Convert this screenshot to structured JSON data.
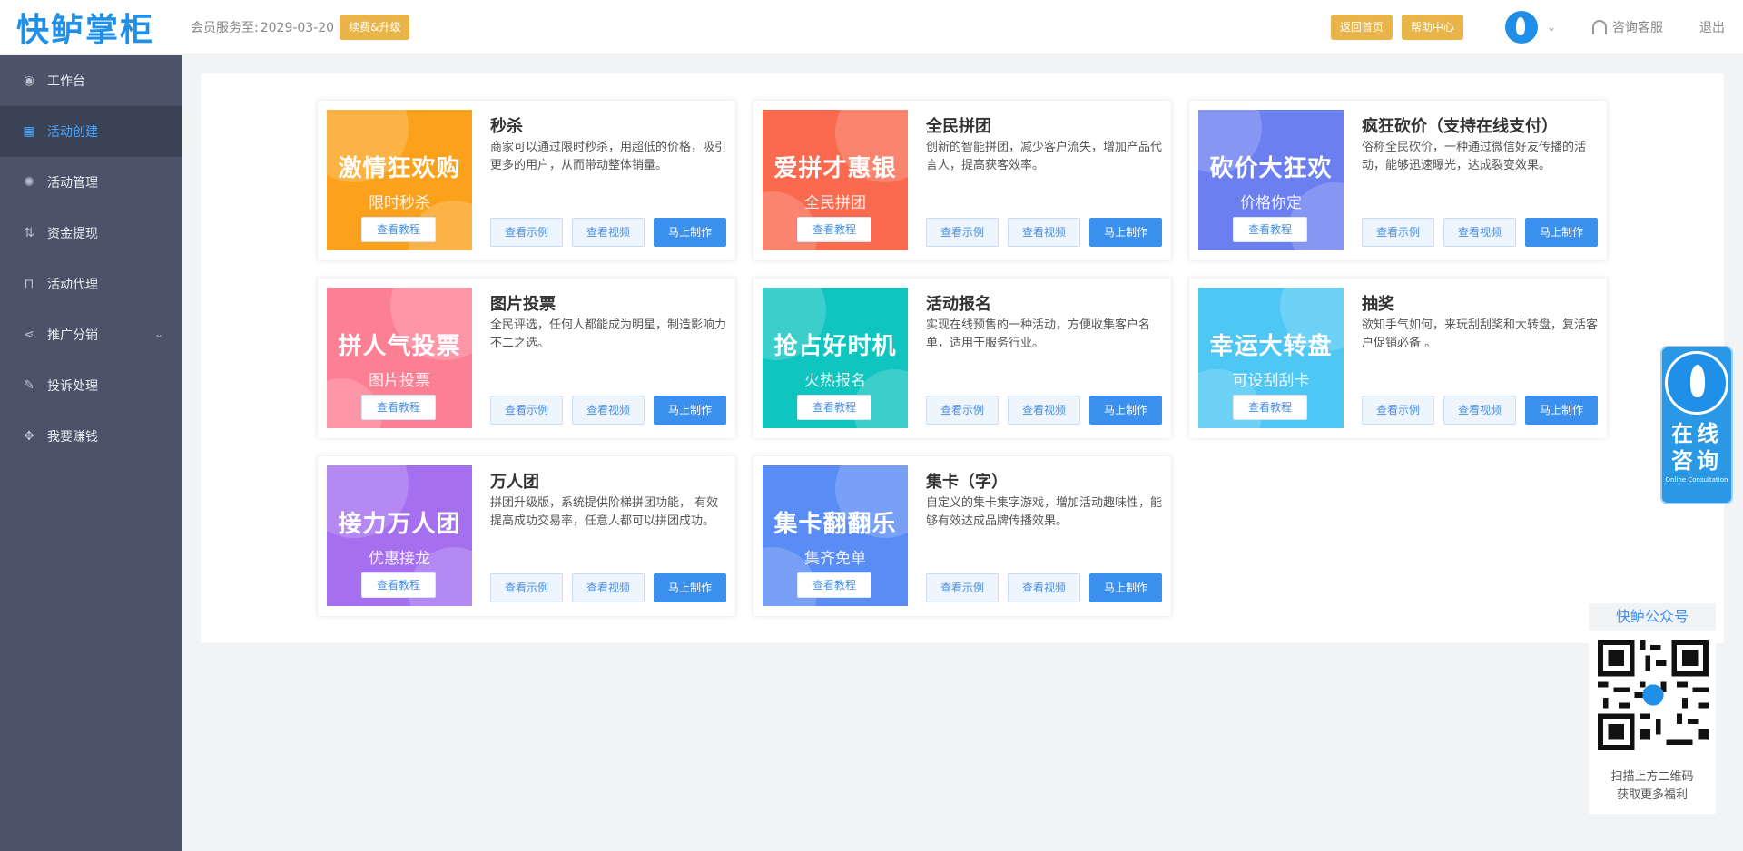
{
  "header": {
    "logo": "快鲈掌柜",
    "member_label": "会员服务至:",
    "member_date": "2029-03-20",
    "renew_button": "续费&升级",
    "home_button": "返回首页",
    "help_button": "帮助中心",
    "service_label": "咨询客服",
    "logout_label": "退出"
  },
  "sidebar": {
    "items": [
      {
        "label": "工作台",
        "icon": "eye-icon"
      },
      {
        "label": "活动创建",
        "icon": "grid-icon",
        "active": true
      },
      {
        "label": "活动管理",
        "icon": "gear-icon"
      },
      {
        "label": "资金提现",
        "icon": "transfer-icon"
      },
      {
        "label": "活动代理",
        "icon": "bag-icon"
      },
      {
        "label": "推广分销",
        "icon": "share-icon"
      },
      {
        "label": "投诉处理",
        "icon": "edit-icon"
      },
      {
        "label": "我要赚钱",
        "icon": "move-icon"
      }
    ]
  },
  "buttons": {
    "tutorial": "查看教程",
    "example": "查看示例",
    "video": "查看视频",
    "make": "马上制作"
  },
  "cards": [
    {
      "title": "秒杀",
      "desc": "商家可以通过限时秒杀，用超低的价格，吸引更多的用户，从而带动整体销量。",
      "banner": "激情狂欢购",
      "sub": "限时秒杀",
      "color": "#fca11c"
    },
    {
      "title": "全民拼团",
      "desc": "创新的智能拼团，减少客户流失，增加产品代言人，提高获客效率。",
      "banner": "爱拼才惠银",
      "sub": "全民拼团",
      "color": "#fb6a4f"
    },
    {
      "title": "疯狂砍价（支持在线支付）",
      "desc": "俗称全民砍价，一种通过微信好友传播的活动，能够迅速曝光，达成裂变效果。",
      "banner": "砍价大狂欢",
      "sub": "价格你定",
      "color": "#6c7ff0"
    },
    {
      "title": "图片投票",
      "desc": "全民评选，任何人都能成为明星，制造影响力不二之选。",
      "banner": "拼人气投票",
      "sub": "图片投票",
      "color": "#fd7f93"
    },
    {
      "title": "活动报名",
      "desc": "实现在线预售的一种活动，方便收集客户名单，适用于服务行业。",
      "banner": "抢占好时机",
      "sub": "火热报名",
      "color": "#10c4c0"
    },
    {
      "title": "抽奖",
      "desc": "欲知手气如何，来玩刮刮奖和大转盘，复活客户促销必备 。",
      "banner": "幸运大转盘",
      "sub": "可设刮刮卡",
      "color": "#4fc7f5"
    },
    {
      "title": "万人团",
      "desc": "拼团升级版，系统提供阶梯拼团功能， 有效提高成功交易率，任意人都可以拼团成功。",
      "banner": "接力万人团",
      "sub": "优惠接龙",
      "color": "#a56ff0"
    },
    {
      "title": "集卡（字）",
      "desc": "自定义的集卡集字游戏，增加活动趣味性，能够有效达成品牌传播效果。",
      "banner": "集卡翻翻乐",
      "sub": "集齐免单",
      "color": "#5a8cf5"
    }
  ],
  "consult": {
    "text_line1": "在线",
    "text_line2": "咨询",
    "text_en": "Online Consultation"
  },
  "qr": {
    "title": "快鲈公众号",
    "line1": "扫描上方二维码",
    "line2": "获取更多福利"
  }
}
